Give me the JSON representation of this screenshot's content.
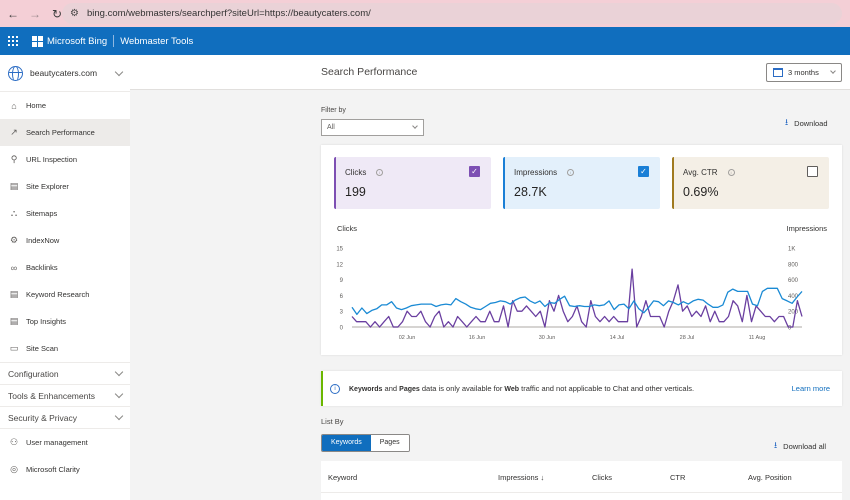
{
  "browser": {
    "url": "bing.com/webmasters/searchperf?siteUrl=https://beautycaters.com/",
    "back_icon": "←",
    "forward_icon": "→",
    "reload_icon": "↻",
    "site_settings_icon": "⚙"
  },
  "appbar": {
    "brand": "Microsoft Bing",
    "product": "Webmaster Tools"
  },
  "sidebar": {
    "site": "beautycaters.com",
    "items": [
      {
        "label": "Home",
        "icon": "⌂"
      },
      {
        "label": "Search Performance",
        "icon": "↗",
        "active": true
      },
      {
        "label": "URL Inspection",
        "icon": "⚲"
      },
      {
        "label": "Site Explorer",
        "icon": "▤"
      },
      {
        "label": "Sitemaps",
        "icon": "⛬"
      },
      {
        "label": "IndexNow",
        "icon": "⚙"
      },
      {
        "label": "Backlinks",
        "icon": "∞"
      },
      {
        "label": "Keyword Research",
        "icon": "▤"
      },
      {
        "label": "Top Insights",
        "icon": "▤"
      },
      {
        "label": "Site Scan",
        "icon": "▭"
      }
    ],
    "sections": [
      "Configuration",
      "Tools & Enhancements",
      "Security & Privacy"
    ],
    "bottom_items": [
      {
        "label": "User management",
        "icon": "⚇"
      },
      {
        "label": "Microsoft Clarity",
        "icon": "◎"
      }
    ]
  },
  "header": {
    "title": "Search Performance",
    "period": "3 months"
  },
  "filter": {
    "label": "Filter by",
    "value": "All"
  },
  "download_label": "Download",
  "cards": [
    {
      "label": "Clicks",
      "value": "199",
      "checked": true,
      "color": "#7d4fb3",
      "bg": "#efe9f6"
    },
    {
      "label": "Impressions",
      "value": "28.7K",
      "checked": true,
      "color": "#1a7fd6",
      "bg": "#e3f0fb"
    },
    {
      "label": "Avg. CTR",
      "value": "0.69%",
      "checked": false,
      "color": "#a07a1f",
      "bg": "#f4efe6"
    }
  ],
  "chart_data": {
    "type": "line",
    "title": "",
    "xlabel": "",
    "ylabel": "Clicks",
    "y2label": "Impressions",
    "ylim": [
      0,
      15
    ],
    "y2lim": [
      0,
      1000
    ],
    "yticks": [
      "0",
      "3",
      "6",
      "9",
      "12",
      "15"
    ],
    "y2ticks": [
      "0",
      "200",
      "400",
      "600",
      "800",
      "1K"
    ],
    "xticks": [
      "02 Jun",
      "16 Jun",
      "30 Jun",
      "14 Jul",
      "28 Jul",
      "11 Aug"
    ],
    "x_start": "22 May",
    "x_end": "20 Aug",
    "series": [
      {
        "name": "Clicks",
        "axis": "left",
        "color": "#6a3fa0",
        "values": [
          2,
          1,
          1,
          1,
          0,
          1,
          0,
          1,
          2,
          0,
          0,
          1,
          3,
          2,
          2,
          3,
          1,
          0,
          2,
          3,
          0,
          1,
          0,
          2,
          1,
          0,
          1,
          2,
          1,
          1,
          3,
          1,
          1,
          4,
          0,
          5,
          3,
          3,
          4,
          3,
          2,
          3,
          0,
          5,
          3,
          6,
          3,
          1,
          2,
          4,
          1,
          0,
          5,
          2,
          1,
          2,
          1,
          2,
          1,
          1,
          1,
          11,
          0,
          2,
          5,
          2,
          2,
          2,
          0,
          3,
          5,
          8,
          3,
          4,
          2,
          3,
          2,
          4,
          1,
          3,
          1,
          1,
          2,
          5,
          4,
          1,
          6,
          1,
          4,
          3,
          2,
          2,
          1,
          2,
          2,
          0,
          0,
          5,
          2
        ]
      },
      {
        "name": "Impressions",
        "axis": "right",
        "color": "#1a8ad4",
        "values": [
          250,
          160,
          240,
          170,
          210,
          230,
          280,
          280,
          320,
          240,
          220,
          240,
          270,
          280,
          290,
          290,
          290,
          260,
          280,
          290,
          280,
          360,
          320,
          290,
          250,
          230,
          220,
          260,
          300,
          310,
          330,
          320,
          290,
          340,
          370,
          380,
          330,
          300,
          330,
          260,
          310,
          300,
          350,
          390,
          270,
          260,
          270,
          260,
          260,
          280,
          270,
          280,
          330,
          220,
          280,
          290,
          230,
          330,
          230,
          180,
          250,
          330,
          320,
          270,
          330,
          310,
          280,
          320,
          290,
          330,
          350,
          340,
          290,
          250,
          250,
          280,
          440,
          480,
          450,
          450,
          450,
          290,
          270,
          450,
          490,
          490,
          490,
          360,
          330,
          300,
          380,
          450
        ]
      }
    ],
    "grid": false,
    "legend": "none"
  },
  "banner": {
    "pre": "",
    "b1": "Keywords",
    "t1": " and ",
    "b2": "Pages",
    "t2": " data is only available for ",
    "b3": "Web",
    "t3": " traffic and not applicable to Chat and other verticals.",
    "link": "Learn more"
  },
  "list": {
    "label": "List By",
    "tabs": [
      {
        "label": "Keywords",
        "active": true
      },
      {
        "label": "Pages",
        "active": false
      }
    ],
    "download_all": "Download all",
    "columns": [
      "Keyword",
      "Impressions ↓",
      "Clicks",
      "CTR",
      "Avg. Position"
    ]
  }
}
